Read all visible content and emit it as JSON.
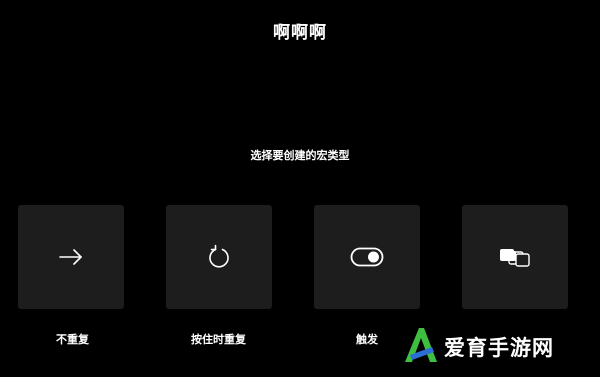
{
  "header": {
    "title": "啊啊啊",
    "subtitle": "选择要创建的宏类型"
  },
  "macro_types": [
    {
      "label": "不重复",
      "icon": "arrow-right-icon"
    },
    {
      "label": "按住时重复",
      "icon": "repeat-icon"
    },
    {
      "label": "触发",
      "icon": "toggle-icon"
    },
    {
      "label": "",
      "icon": "layers-icon"
    }
  ],
  "watermark": {
    "text": "爱育手游网",
    "icon": "logo-a-icon"
  },
  "colors": {
    "background": "#000000",
    "card": "#1d1d1d",
    "text": "#ffffff",
    "logo_green": "#3fbf3f",
    "logo_blue": "#2b6fd6"
  }
}
